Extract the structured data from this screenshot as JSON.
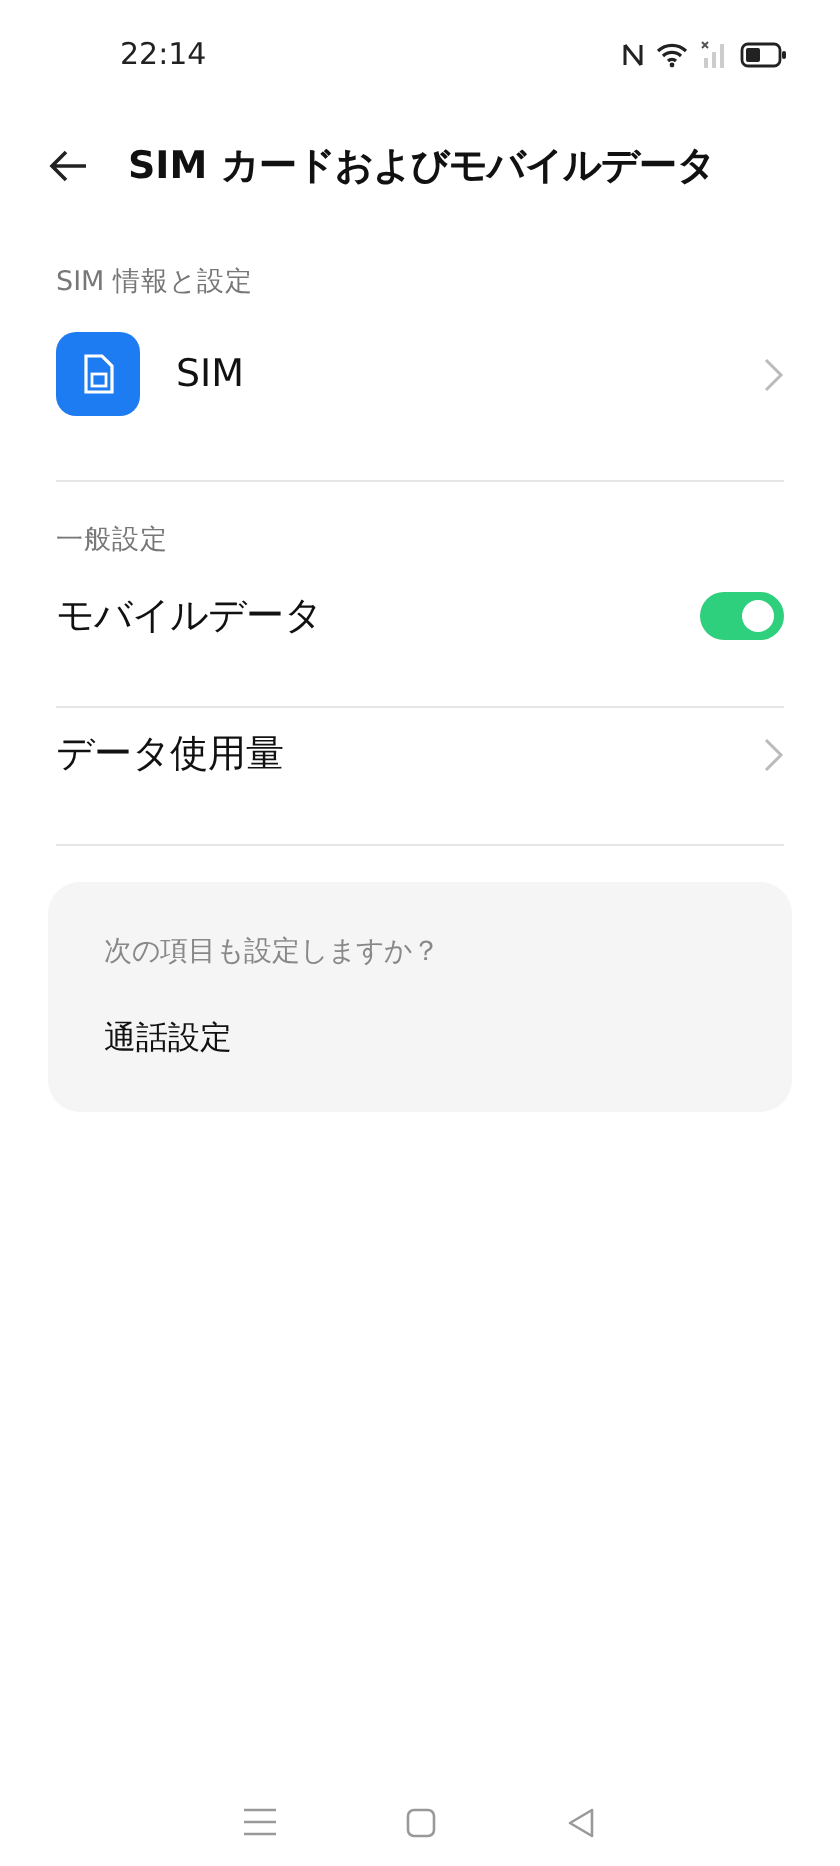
{
  "status_bar": {
    "time": "22:14"
  },
  "header": {
    "title": "SIM カードおよびモバイルデータ"
  },
  "sections": [
    {
      "header": "SIM 情報と設定",
      "items": [
        {
          "kind": "sim",
          "label": "SIM"
        }
      ]
    },
    {
      "header": "一般設定",
      "items": [
        {
          "kind": "toggle",
          "label": "モバイルデータ",
          "on": true
        },
        {
          "kind": "link",
          "label": "データ使用量"
        }
      ]
    }
  ],
  "suggestion_card": {
    "title": "次の項目も設定しますか？",
    "items": [
      "通話設定"
    ]
  }
}
